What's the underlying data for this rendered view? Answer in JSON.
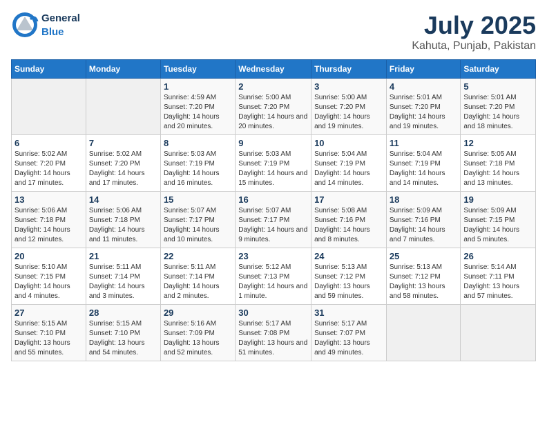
{
  "header": {
    "logo_general": "General",
    "logo_blue": "Blue",
    "title": "July 2025",
    "subtitle": "Kahuta, Punjab, Pakistan"
  },
  "calendar": {
    "days_of_week": [
      "Sunday",
      "Monday",
      "Tuesday",
      "Wednesday",
      "Thursday",
      "Friday",
      "Saturday"
    ],
    "weeks": [
      [
        {
          "day": null
        },
        {
          "day": null
        },
        {
          "day": "1",
          "sunrise": "Sunrise: 4:59 AM",
          "sunset": "Sunset: 7:20 PM",
          "daylight": "Daylight: 14 hours and 20 minutes."
        },
        {
          "day": "2",
          "sunrise": "Sunrise: 5:00 AM",
          "sunset": "Sunset: 7:20 PM",
          "daylight": "Daylight: 14 hours and 20 minutes."
        },
        {
          "day": "3",
          "sunrise": "Sunrise: 5:00 AM",
          "sunset": "Sunset: 7:20 PM",
          "daylight": "Daylight: 14 hours and 19 minutes."
        },
        {
          "day": "4",
          "sunrise": "Sunrise: 5:01 AM",
          "sunset": "Sunset: 7:20 PM",
          "daylight": "Daylight: 14 hours and 19 minutes."
        },
        {
          "day": "5",
          "sunrise": "Sunrise: 5:01 AM",
          "sunset": "Sunset: 7:20 PM",
          "daylight": "Daylight: 14 hours and 18 minutes."
        }
      ],
      [
        {
          "day": "6",
          "sunrise": "Sunrise: 5:02 AM",
          "sunset": "Sunset: 7:20 PM",
          "daylight": "Daylight: 14 hours and 17 minutes."
        },
        {
          "day": "7",
          "sunrise": "Sunrise: 5:02 AM",
          "sunset": "Sunset: 7:20 PM",
          "daylight": "Daylight: 14 hours and 17 minutes."
        },
        {
          "day": "8",
          "sunrise": "Sunrise: 5:03 AM",
          "sunset": "Sunset: 7:19 PM",
          "daylight": "Daylight: 14 hours and 16 minutes."
        },
        {
          "day": "9",
          "sunrise": "Sunrise: 5:03 AM",
          "sunset": "Sunset: 7:19 PM",
          "daylight": "Daylight: 14 hours and 15 minutes."
        },
        {
          "day": "10",
          "sunrise": "Sunrise: 5:04 AM",
          "sunset": "Sunset: 7:19 PM",
          "daylight": "Daylight: 14 hours and 14 minutes."
        },
        {
          "day": "11",
          "sunrise": "Sunrise: 5:04 AM",
          "sunset": "Sunset: 7:19 PM",
          "daylight": "Daylight: 14 hours and 14 minutes."
        },
        {
          "day": "12",
          "sunrise": "Sunrise: 5:05 AM",
          "sunset": "Sunset: 7:18 PM",
          "daylight": "Daylight: 14 hours and 13 minutes."
        }
      ],
      [
        {
          "day": "13",
          "sunrise": "Sunrise: 5:06 AM",
          "sunset": "Sunset: 7:18 PM",
          "daylight": "Daylight: 14 hours and 12 minutes."
        },
        {
          "day": "14",
          "sunrise": "Sunrise: 5:06 AM",
          "sunset": "Sunset: 7:18 PM",
          "daylight": "Daylight: 14 hours and 11 minutes."
        },
        {
          "day": "15",
          "sunrise": "Sunrise: 5:07 AM",
          "sunset": "Sunset: 7:17 PM",
          "daylight": "Daylight: 14 hours and 10 minutes."
        },
        {
          "day": "16",
          "sunrise": "Sunrise: 5:07 AM",
          "sunset": "Sunset: 7:17 PM",
          "daylight": "Daylight: 14 hours and 9 minutes."
        },
        {
          "day": "17",
          "sunrise": "Sunrise: 5:08 AM",
          "sunset": "Sunset: 7:16 PM",
          "daylight": "Daylight: 14 hours and 8 minutes."
        },
        {
          "day": "18",
          "sunrise": "Sunrise: 5:09 AM",
          "sunset": "Sunset: 7:16 PM",
          "daylight": "Daylight: 14 hours and 7 minutes."
        },
        {
          "day": "19",
          "sunrise": "Sunrise: 5:09 AM",
          "sunset": "Sunset: 7:15 PM",
          "daylight": "Daylight: 14 hours and 5 minutes."
        }
      ],
      [
        {
          "day": "20",
          "sunrise": "Sunrise: 5:10 AM",
          "sunset": "Sunset: 7:15 PM",
          "daylight": "Daylight: 14 hours and 4 minutes."
        },
        {
          "day": "21",
          "sunrise": "Sunrise: 5:11 AM",
          "sunset": "Sunset: 7:14 PM",
          "daylight": "Daylight: 14 hours and 3 minutes."
        },
        {
          "day": "22",
          "sunrise": "Sunrise: 5:11 AM",
          "sunset": "Sunset: 7:14 PM",
          "daylight": "Daylight: 14 hours and 2 minutes."
        },
        {
          "day": "23",
          "sunrise": "Sunrise: 5:12 AM",
          "sunset": "Sunset: 7:13 PM",
          "daylight": "Daylight: 14 hours and 1 minute."
        },
        {
          "day": "24",
          "sunrise": "Sunrise: 5:13 AM",
          "sunset": "Sunset: 7:12 PM",
          "daylight": "Daylight: 13 hours and 59 minutes."
        },
        {
          "day": "25",
          "sunrise": "Sunrise: 5:13 AM",
          "sunset": "Sunset: 7:12 PM",
          "daylight": "Daylight: 13 hours and 58 minutes."
        },
        {
          "day": "26",
          "sunrise": "Sunrise: 5:14 AM",
          "sunset": "Sunset: 7:11 PM",
          "daylight": "Daylight: 13 hours and 57 minutes."
        }
      ],
      [
        {
          "day": "27",
          "sunrise": "Sunrise: 5:15 AM",
          "sunset": "Sunset: 7:10 PM",
          "daylight": "Daylight: 13 hours and 55 minutes."
        },
        {
          "day": "28",
          "sunrise": "Sunrise: 5:15 AM",
          "sunset": "Sunset: 7:10 PM",
          "daylight": "Daylight: 13 hours and 54 minutes."
        },
        {
          "day": "29",
          "sunrise": "Sunrise: 5:16 AM",
          "sunset": "Sunset: 7:09 PM",
          "daylight": "Daylight: 13 hours and 52 minutes."
        },
        {
          "day": "30",
          "sunrise": "Sunrise: 5:17 AM",
          "sunset": "Sunset: 7:08 PM",
          "daylight": "Daylight: 13 hours and 51 minutes."
        },
        {
          "day": "31",
          "sunrise": "Sunrise: 5:17 AM",
          "sunset": "Sunset: 7:07 PM",
          "daylight": "Daylight: 13 hours and 49 minutes."
        },
        {
          "day": null
        },
        {
          "day": null
        }
      ]
    ]
  }
}
